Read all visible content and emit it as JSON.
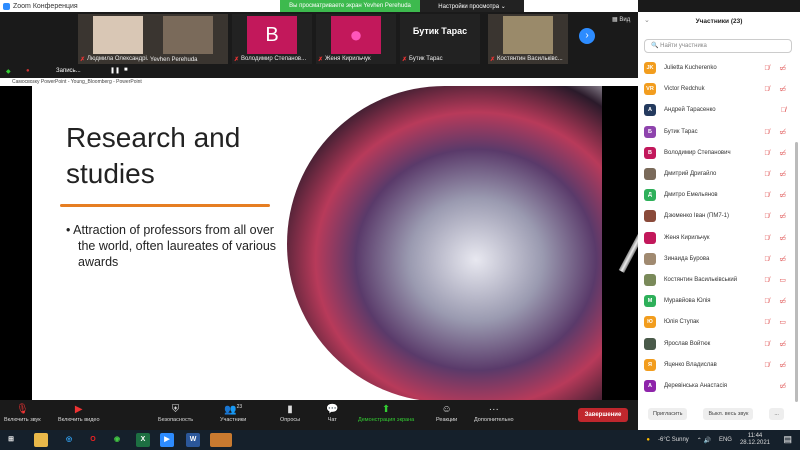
{
  "window": {
    "title": "Zoom Конференция",
    "banner": "Вы просматриваете экран Yevhen Perehuda",
    "view_options": "Настройки просмотра ⌄",
    "view": "Вид"
  },
  "gallery": [
    {
      "name": "Людмила Олександрі...",
      "muted": true,
      "type": "video",
      "color": "#d9c7b5"
    },
    {
      "name": "Yevhen Perehuda",
      "muted": false,
      "type": "video",
      "color": "#7a6a5a"
    },
    {
      "name": "Володимир Степанов...",
      "muted": true,
      "type": "letter",
      "letter": "B",
      "color": "#c2185b"
    },
    {
      "name": "Женя Кирильчук",
      "muted": true,
      "type": "avatar",
      "color": "#c2185b"
    },
    {
      "name": "Бутик Тарас",
      "muted": true,
      "type": "text",
      "big": "Бутик Тарас"
    },
    {
      "name": "Костянтин Васильківс...",
      "muted": true,
      "type": "video",
      "color": "#9a8a6a"
    }
  ],
  "recording": {
    "label": "Запись..."
  },
  "ppt_title": "Cамосвозку PowerPoint - Young_Bloomberg - PowerPoint",
  "slide": {
    "title": "Research and studies",
    "bullets": [
      "Attraction of professors from all over the world, often laureates of various awards"
    ]
  },
  "panel": {
    "title": "Участники (23)",
    "search_placeholder": "Найти участника",
    "invite": "Пригласить",
    "mute_all": "Выкл. весь звук",
    "more": "...",
    "participants": [
      {
        "name": "Julietta Kucherenko",
        "initials": "JK",
        "color": "#f29d1e",
        "icons": "🎙̸ ▭̸"
      },
      {
        "name": "Victor Redchuk",
        "initials": "VR",
        "color": "#f29d1e",
        "icons": "🎙̸ ▭̸"
      },
      {
        "name": "Андрей Тарасенко",
        "initials": "A",
        "color": "#243a5e",
        "icons": "🎙̸"
      },
      {
        "name": "Бутик Тарас",
        "initials": "Б",
        "color": "#8e44ad",
        "icons": "🎙̸ ▭̸"
      },
      {
        "name": "Володимир Степанович",
        "initials": "В",
        "color": "#c2185b",
        "icons": "🎙̸ ▭̸"
      },
      {
        "name": "Дмитрий Дригайло",
        "initials": "",
        "color": "#7a6a5a",
        "icons": "🎙̸ ▭̸"
      },
      {
        "name": "Дмитро Емельянов",
        "initials": "Д",
        "color": "#2eb05a",
        "icons": "🎙̸ ▭̸"
      },
      {
        "name": "Дзюменко Іван (ПМ7-1)",
        "initials": "",
        "color": "#8a4a3a",
        "icons": "🎙̸ ▭̸"
      },
      {
        "name": "Женя Кирильчук",
        "initials": "",
        "color": "#c2185b",
        "icons": "🎙̸ ▭̸"
      },
      {
        "name": "Зинаида Бурова",
        "initials": "",
        "color": "#a08a70",
        "icons": "🎙̸ ▭̸"
      },
      {
        "name": "Костянтин Васильківський",
        "initials": "",
        "color": "#7a8a5a",
        "icons": "🎙̸ ▭"
      },
      {
        "name": "Муравйова Юлія",
        "initials": "М",
        "color": "#2eb05a",
        "icons": "🎙̸ ▭̸"
      },
      {
        "name": "Юлія Ступак",
        "initials": "Ю",
        "color": "#f29d1e",
        "icons": "🎙̸ ▭"
      },
      {
        "name": "Ярослав Войтюк",
        "initials": "",
        "color": "#4a5a4a",
        "icons": "🎙̸ ▭̸"
      },
      {
        "name": "Яценко Владислав",
        "initials": "Я",
        "color": "#f29d1e",
        "icons": "🎙̸ ▭̸"
      },
      {
        "name": "Деревінська Анастасія",
        "initials": "А",
        "color": "#8e24aa",
        "icons": "▭̸"
      }
    ]
  },
  "toolbar": {
    "unmute": "Включить звук",
    "video": "Включить видео",
    "security": "Безопасность",
    "participants": "Участники",
    "participants_count": "23",
    "polls": "Опросы",
    "chat": "Чат",
    "share": "Демонстрация экрана",
    "reactions": "Реакции",
    "more": "Дополнительно",
    "end": "Завершение"
  },
  "taskbar": {
    "weather": "-6°C  Sunny",
    "lang": "ENG",
    "time": "11:44",
    "date": "28.12.2021"
  }
}
